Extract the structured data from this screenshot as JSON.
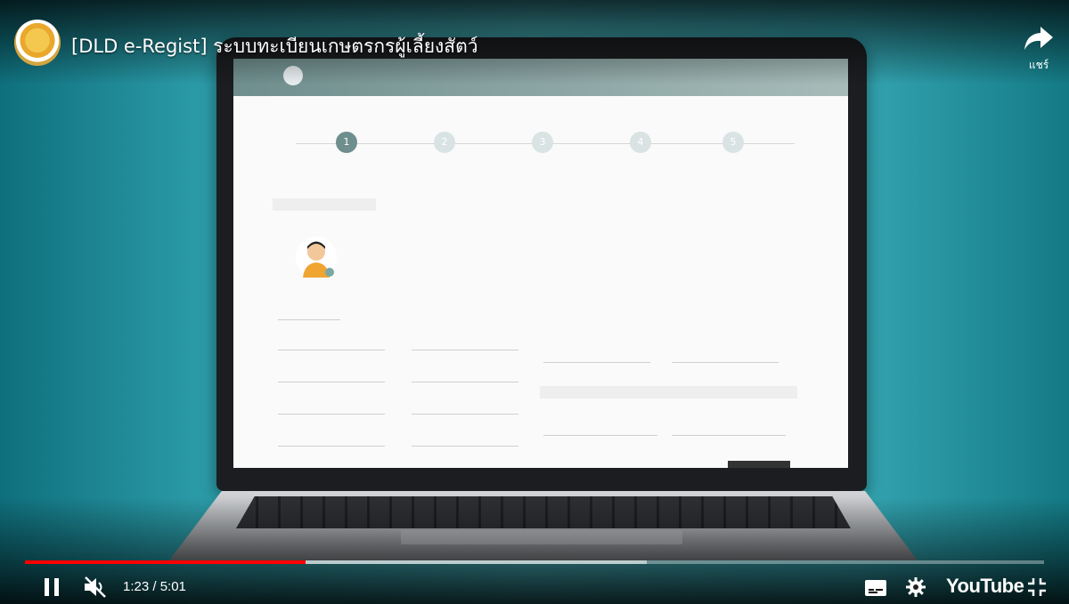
{
  "video": {
    "title": "[DLD e-Regist] ระบบทะเบียนเกษตรกรผู้เลี้ยงสัตว์",
    "share_label": "แชร์",
    "brand": "YouTube"
  },
  "player": {
    "time_display": "1:23 / 5:01",
    "progress_fraction": 0.2757,
    "buffered_fraction": 0.61,
    "accent_color": "#ff0000",
    "is_playing": true,
    "muted": true
  },
  "screen_app": {
    "steps": [
      {
        "number": "1"
      },
      {
        "number": "2"
      },
      {
        "number": "3"
      },
      {
        "number": "4"
      },
      {
        "number": "5"
      }
    ]
  },
  "icons": {
    "pause": "pause-icon",
    "mute": "muted-speaker-icon",
    "captions": "subtitles-icon",
    "settings": "gear-icon",
    "fullscreen": "exit-fullscreen-icon",
    "share": "share-arrow-icon"
  }
}
